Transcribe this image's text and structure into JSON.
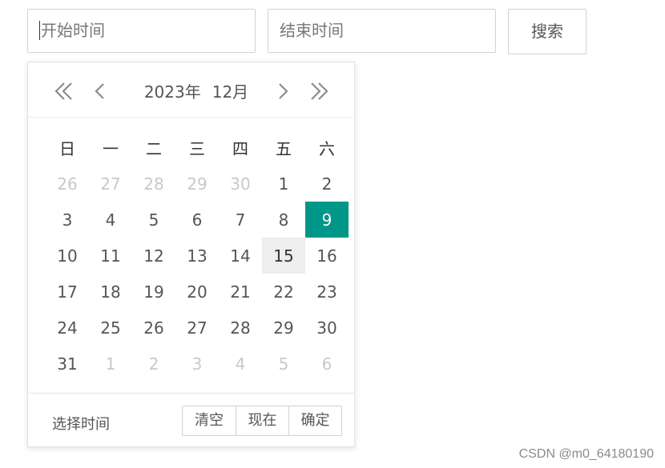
{
  "form": {
    "start_placeholder": "开始时间",
    "end_placeholder": "结束时间",
    "search_label": "搜索"
  },
  "picker": {
    "year_label": "2023年",
    "month_label": "12月",
    "weekdays": [
      "日",
      "一",
      "二",
      "三",
      "四",
      "五",
      "六"
    ],
    "weeks": [
      [
        {
          "d": "26",
          "other": true
        },
        {
          "d": "27",
          "other": true
        },
        {
          "d": "28",
          "other": true
        },
        {
          "d": "29",
          "other": true
        },
        {
          "d": "30",
          "other": true
        },
        {
          "d": "1"
        },
        {
          "d": "2"
        }
      ],
      [
        {
          "d": "3"
        },
        {
          "d": "4"
        },
        {
          "d": "5"
        },
        {
          "d": "6"
        },
        {
          "d": "7"
        },
        {
          "d": "8"
        },
        {
          "d": "9",
          "selected": true
        }
      ],
      [
        {
          "d": "10"
        },
        {
          "d": "11"
        },
        {
          "d": "12"
        },
        {
          "d": "13"
        },
        {
          "d": "14"
        },
        {
          "d": "15",
          "hover": true
        },
        {
          "d": "16"
        }
      ],
      [
        {
          "d": "17"
        },
        {
          "d": "18"
        },
        {
          "d": "19"
        },
        {
          "d": "20"
        },
        {
          "d": "21"
        },
        {
          "d": "22"
        },
        {
          "d": "23"
        }
      ],
      [
        {
          "d": "24"
        },
        {
          "d": "25"
        },
        {
          "d": "26"
        },
        {
          "d": "27"
        },
        {
          "d": "28"
        },
        {
          "d": "29"
        },
        {
          "d": "30"
        }
      ],
      [
        {
          "d": "31"
        },
        {
          "d": "1",
          "other": true
        },
        {
          "d": "2",
          "other": true
        },
        {
          "d": "3",
          "other": true
        },
        {
          "d": "4",
          "other": true
        },
        {
          "d": "5",
          "other": true
        },
        {
          "d": "6",
          "other": true
        }
      ]
    ],
    "footer": {
      "select_time_label": "选择时间",
      "clear_label": "清空",
      "now_label": "现在",
      "confirm_label": "确定"
    },
    "accent_color": "#009688"
  },
  "watermark": "CSDN @m0_64180190"
}
